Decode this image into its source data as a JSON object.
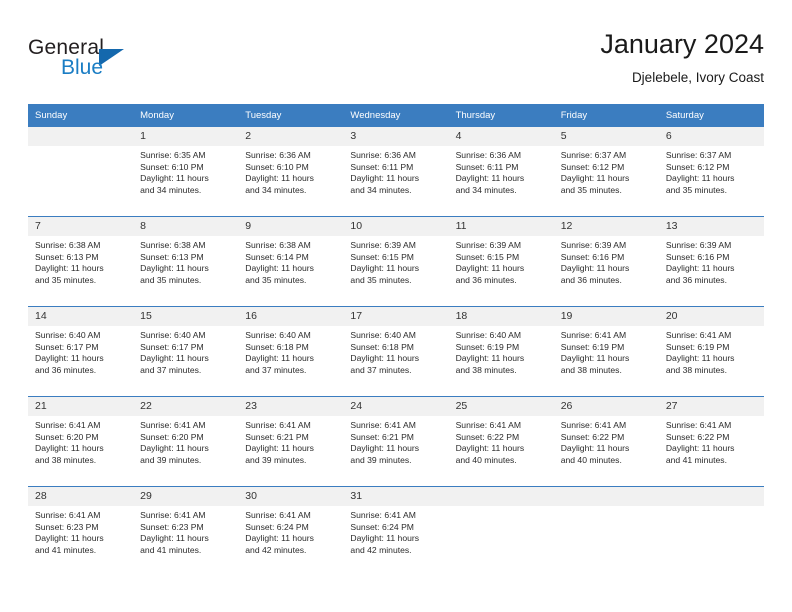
{
  "brand": {
    "name_part1": "General",
    "name_part2": "Blue",
    "accent_color": "#1a7dc4",
    "triangle_color": "#1468ad"
  },
  "header": {
    "title": "January 2024",
    "subtitle": "Djelebele, Ivory Coast"
  },
  "calendar": {
    "header_bg": "#3b7dc0",
    "daynum_bg": "#f1f1f1",
    "weekdays": [
      "Sunday",
      "Monday",
      "Tuesday",
      "Wednesday",
      "Thursday",
      "Friday",
      "Saturday"
    ],
    "weeks": [
      [
        {
          "day": "",
          "sunrise": "",
          "sunset": "",
          "daylight_line1": "",
          "daylight_line2": "",
          "empty": true
        },
        {
          "day": "1",
          "sunrise": "Sunrise: 6:35 AM",
          "sunset": "Sunset: 6:10 PM",
          "daylight_line1": "Daylight: 11 hours",
          "daylight_line2": "and 34 minutes."
        },
        {
          "day": "2",
          "sunrise": "Sunrise: 6:36 AM",
          "sunset": "Sunset: 6:10 PM",
          "daylight_line1": "Daylight: 11 hours",
          "daylight_line2": "and 34 minutes."
        },
        {
          "day": "3",
          "sunrise": "Sunrise: 6:36 AM",
          "sunset": "Sunset: 6:11 PM",
          "daylight_line1": "Daylight: 11 hours",
          "daylight_line2": "and 34 minutes."
        },
        {
          "day": "4",
          "sunrise": "Sunrise: 6:36 AM",
          "sunset": "Sunset: 6:11 PM",
          "daylight_line1": "Daylight: 11 hours",
          "daylight_line2": "and 34 minutes."
        },
        {
          "day": "5",
          "sunrise": "Sunrise: 6:37 AM",
          "sunset": "Sunset: 6:12 PM",
          "daylight_line1": "Daylight: 11 hours",
          "daylight_line2": "and 35 minutes."
        },
        {
          "day": "6",
          "sunrise": "Sunrise: 6:37 AM",
          "sunset": "Sunset: 6:12 PM",
          "daylight_line1": "Daylight: 11 hours",
          "daylight_line2": "and 35 minutes."
        }
      ],
      [
        {
          "day": "7",
          "sunrise": "Sunrise: 6:38 AM",
          "sunset": "Sunset: 6:13 PM",
          "daylight_line1": "Daylight: 11 hours",
          "daylight_line2": "and 35 minutes."
        },
        {
          "day": "8",
          "sunrise": "Sunrise: 6:38 AM",
          "sunset": "Sunset: 6:13 PM",
          "daylight_line1": "Daylight: 11 hours",
          "daylight_line2": "and 35 minutes."
        },
        {
          "day": "9",
          "sunrise": "Sunrise: 6:38 AM",
          "sunset": "Sunset: 6:14 PM",
          "daylight_line1": "Daylight: 11 hours",
          "daylight_line2": "and 35 minutes."
        },
        {
          "day": "10",
          "sunrise": "Sunrise: 6:39 AM",
          "sunset": "Sunset: 6:15 PM",
          "daylight_line1": "Daylight: 11 hours",
          "daylight_line2": "and 35 minutes."
        },
        {
          "day": "11",
          "sunrise": "Sunrise: 6:39 AM",
          "sunset": "Sunset: 6:15 PM",
          "daylight_line1": "Daylight: 11 hours",
          "daylight_line2": "and 36 minutes."
        },
        {
          "day": "12",
          "sunrise": "Sunrise: 6:39 AM",
          "sunset": "Sunset: 6:16 PM",
          "daylight_line1": "Daylight: 11 hours",
          "daylight_line2": "and 36 minutes."
        },
        {
          "day": "13",
          "sunrise": "Sunrise: 6:39 AM",
          "sunset": "Sunset: 6:16 PM",
          "daylight_line1": "Daylight: 11 hours",
          "daylight_line2": "and 36 minutes."
        }
      ],
      [
        {
          "day": "14",
          "sunrise": "Sunrise: 6:40 AM",
          "sunset": "Sunset: 6:17 PM",
          "daylight_line1": "Daylight: 11 hours",
          "daylight_line2": "and 36 minutes."
        },
        {
          "day": "15",
          "sunrise": "Sunrise: 6:40 AM",
          "sunset": "Sunset: 6:17 PM",
          "daylight_line1": "Daylight: 11 hours",
          "daylight_line2": "and 37 minutes."
        },
        {
          "day": "16",
          "sunrise": "Sunrise: 6:40 AM",
          "sunset": "Sunset: 6:18 PM",
          "daylight_line1": "Daylight: 11 hours",
          "daylight_line2": "and 37 minutes."
        },
        {
          "day": "17",
          "sunrise": "Sunrise: 6:40 AM",
          "sunset": "Sunset: 6:18 PM",
          "daylight_line1": "Daylight: 11 hours",
          "daylight_line2": "and 37 minutes."
        },
        {
          "day": "18",
          "sunrise": "Sunrise: 6:40 AM",
          "sunset": "Sunset: 6:19 PM",
          "daylight_line1": "Daylight: 11 hours",
          "daylight_line2": "and 38 minutes."
        },
        {
          "day": "19",
          "sunrise": "Sunrise: 6:41 AM",
          "sunset": "Sunset: 6:19 PM",
          "daylight_line1": "Daylight: 11 hours",
          "daylight_line2": "and 38 minutes."
        },
        {
          "day": "20",
          "sunrise": "Sunrise: 6:41 AM",
          "sunset": "Sunset: 6:19 PM",
          "daylight_line1": "Daylight: 11 hours",
          "daylight_line2": "and 38 minutes."
        }
      ],
      [
        {
          "day": "21",
          "sunrise": "Sunrise: 6:41 AM",
          "sunset": "Sunset: 6:20 PM",
          "daylight_line1": "Daylight: 11 hours",
          "daylight_line2": "and 38 minutes."
        },
        {
          "day": "22",
          "sunrise": "Sunrise: 6:41 AM",
          "sunset": "Sunset: 6:20 PM",
          "daylight_line1": "Daylight: 11 hours",
          "daylight_line2": "and 39 minutes."
        },
        {
          "day": "23",
          "sunrise": "Sunrise: 6:41 AM",
          "sunset": "Sunset: 6:21 PM",
          "daylight_line1": "Daylight: 11 hours",
          "daylight_line2": "and 39 minutes."
        },
        {
          "day": "24",
          "sunrise": "Sunrise: 6:41 AM",
          "sunset": "Sunset: 6:21 PM",
          "daylight_line1": "Daylight: 11 hours",
          "daylight_line2": "and 39 minutes."
        },
        {
          "day": "25",
          "sunrise": "Sunrise: 6:41 AM",
          "sunset": "Sunset: 6:22 PM",
          "daylight_line1": "Daylight: 11 hours",
          "daylight_line2": "and 40 minutes."
        },
        {
          "day": "26",
          "sunrise": "Sunrise: 6:41 AM",
          "sunset": "Sunset: 6:22 PM",
          "daylight_line1": "Daylight: 11 hours",
          "daylight_line2": "and 40 minutes."
        },
        {
          "day": "27",
          "sunrise": "Sunrise: 6:41 AM",
          "sunset": "Sunset: 6:22 PM",
          "daylight_line1": "Daylight: 11 hours",
          "daylight_line2": "and 41 minutes."
        }
      ],
      [
        {
          "day": "28",
          "sunrise": "Sunrise: 6:41 AM",
          "sunset": "Sunset: 6:23 PM",
          "daylight_line1": "Daylight: 11 hours",
          "daylight_line2": "and 41 minutes."
        },
        {
          "day": "29",
          "sunrise": "Sunrise: 6:41 AM",
          "sunset": "Sunset: 6:23 PM",
          "daylight_line1": "Daylight: 11 hours",
          "daylight_line2": "and 41 minutes."
        },
        {
          "day": "30",
          "sunrise": "Sunrise: 6:41 AM",
          "sunset": "Sunset: 6:24 PM",
          "daylight_line1": "Daylight: 11 hours",
          "daylight_line2": "and 42 minutes."
        },
        {
          "day": "31",
          "sunrise": "Sunrise: 6:41 AM",
          "sunset": "Sunset: 6:24 PM",
          "daylight_line1": "Daylight: 11 hours",
          "daylight_line2": "and 42 minutes."
        },
        {
          "day": "",
          "sunrise": "",
          "sunset": "",
          "daylight_line1": "",
          "daylight_line2": "",
          "empty": true
        },
        {
          "day": "",
          "sunrise": "",
          "sunset": "",
          "daylight_line1": "",
          "daylight_line2": "",
          "empty": true
        },
        {
          "day": "",
          "sunrise": "",
          "sunset": "",
          "daylight_line1": "",
          "daylight_line2": "",
          "empty": true
        }
      ]
    ]
  }
}
